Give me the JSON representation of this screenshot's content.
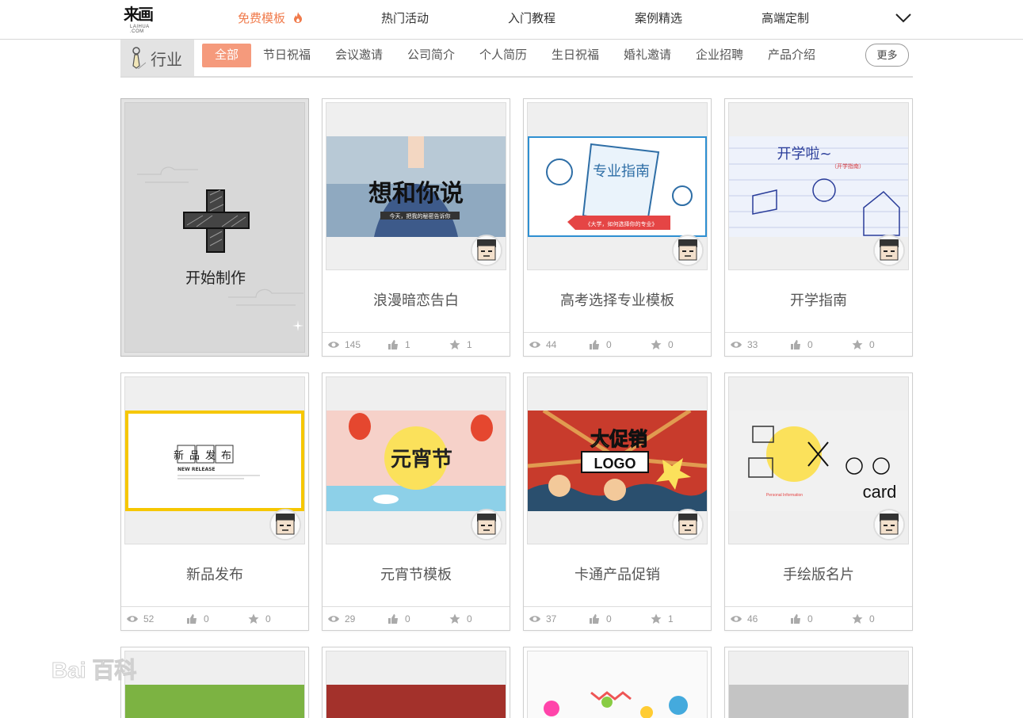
{
  "nav": {
    "logo_text": "来画",
    "logo_sub": "LAIHUA .COM",
    "items": [
      {
        "label": "免费模板",
        "active": true
      },
      {
        "label": "热门活动",
        "active": false
      },
      {
        "label": "入门教程",
        "active": false
      },
      {
        "label": "案例精选",
        "active": false
      },
      {
        "label": "高端定制",
        "active": false
      }
    ],
    "accent_color": "#f07b4c"
  },
  "categories": {
    "group_label": "行业",
    "items": [
      "全部",
      "节日祝福",
      "会议邀请",
      "公司简介",
      "个人简历",
      "生日祝福",
      "婚礼邀请",
      "企业招聘",
      "产品介绍"
    ],
    "selected": "全部",
    "more_label": "更多"
  },
  "start_card": {
    "label": "开始制作"
  },
  "templates": [
    {
      "title": "浪漫暗恋告白",
      "art_text": "想和你说",
      "art_sub": "今天，把我的秘密告诉你",
      "views": "145",
      "likes": "1",
      "favorites": "1"
    },
    {
      "title": "高考选择专业模板",
      "art_text": "专业指南",
      "art_sub": "《大学，如何选择你的专业》",
      "views": "44",
      "likes": "0",
      "favorites": "0"
    },
    {
      "title": "开学指南",
      "art_text": "开学啦~",
      "art_sub": "（开学指南）",
      "views": "33",
      "likes": "0",
      "favorites": "0"
    },
    {
      "title": "新品发布",
      "art_text": "新品发布",
      "art_sub": "NEW RELEASE",
      "views": "52",
      "likes": "0",
      "favorites": "0"
    },
    {
      "title": "元宵节模板",
      "art_text": "元宵节",
      "art_sub": "",
      "views": "29",
      "likes": "0",
      "favorites": "0"
    },
    {
      "title": "卡通产品促销",
      "art_text": "大促销",
      "art_sub": "LOGO",
      "views": "37",
      "likes": "0",
      "favorites": "1"
    },
    {
      "title": "手绘版名片",
      "art_text": "card",
      "art_sub": "Personal Information",
      "views": "46",
      "likes": "0",
      "favorites": "0"
    }
  ],
  "watermark": {
    "text": "Bai 百科"
  }
}
